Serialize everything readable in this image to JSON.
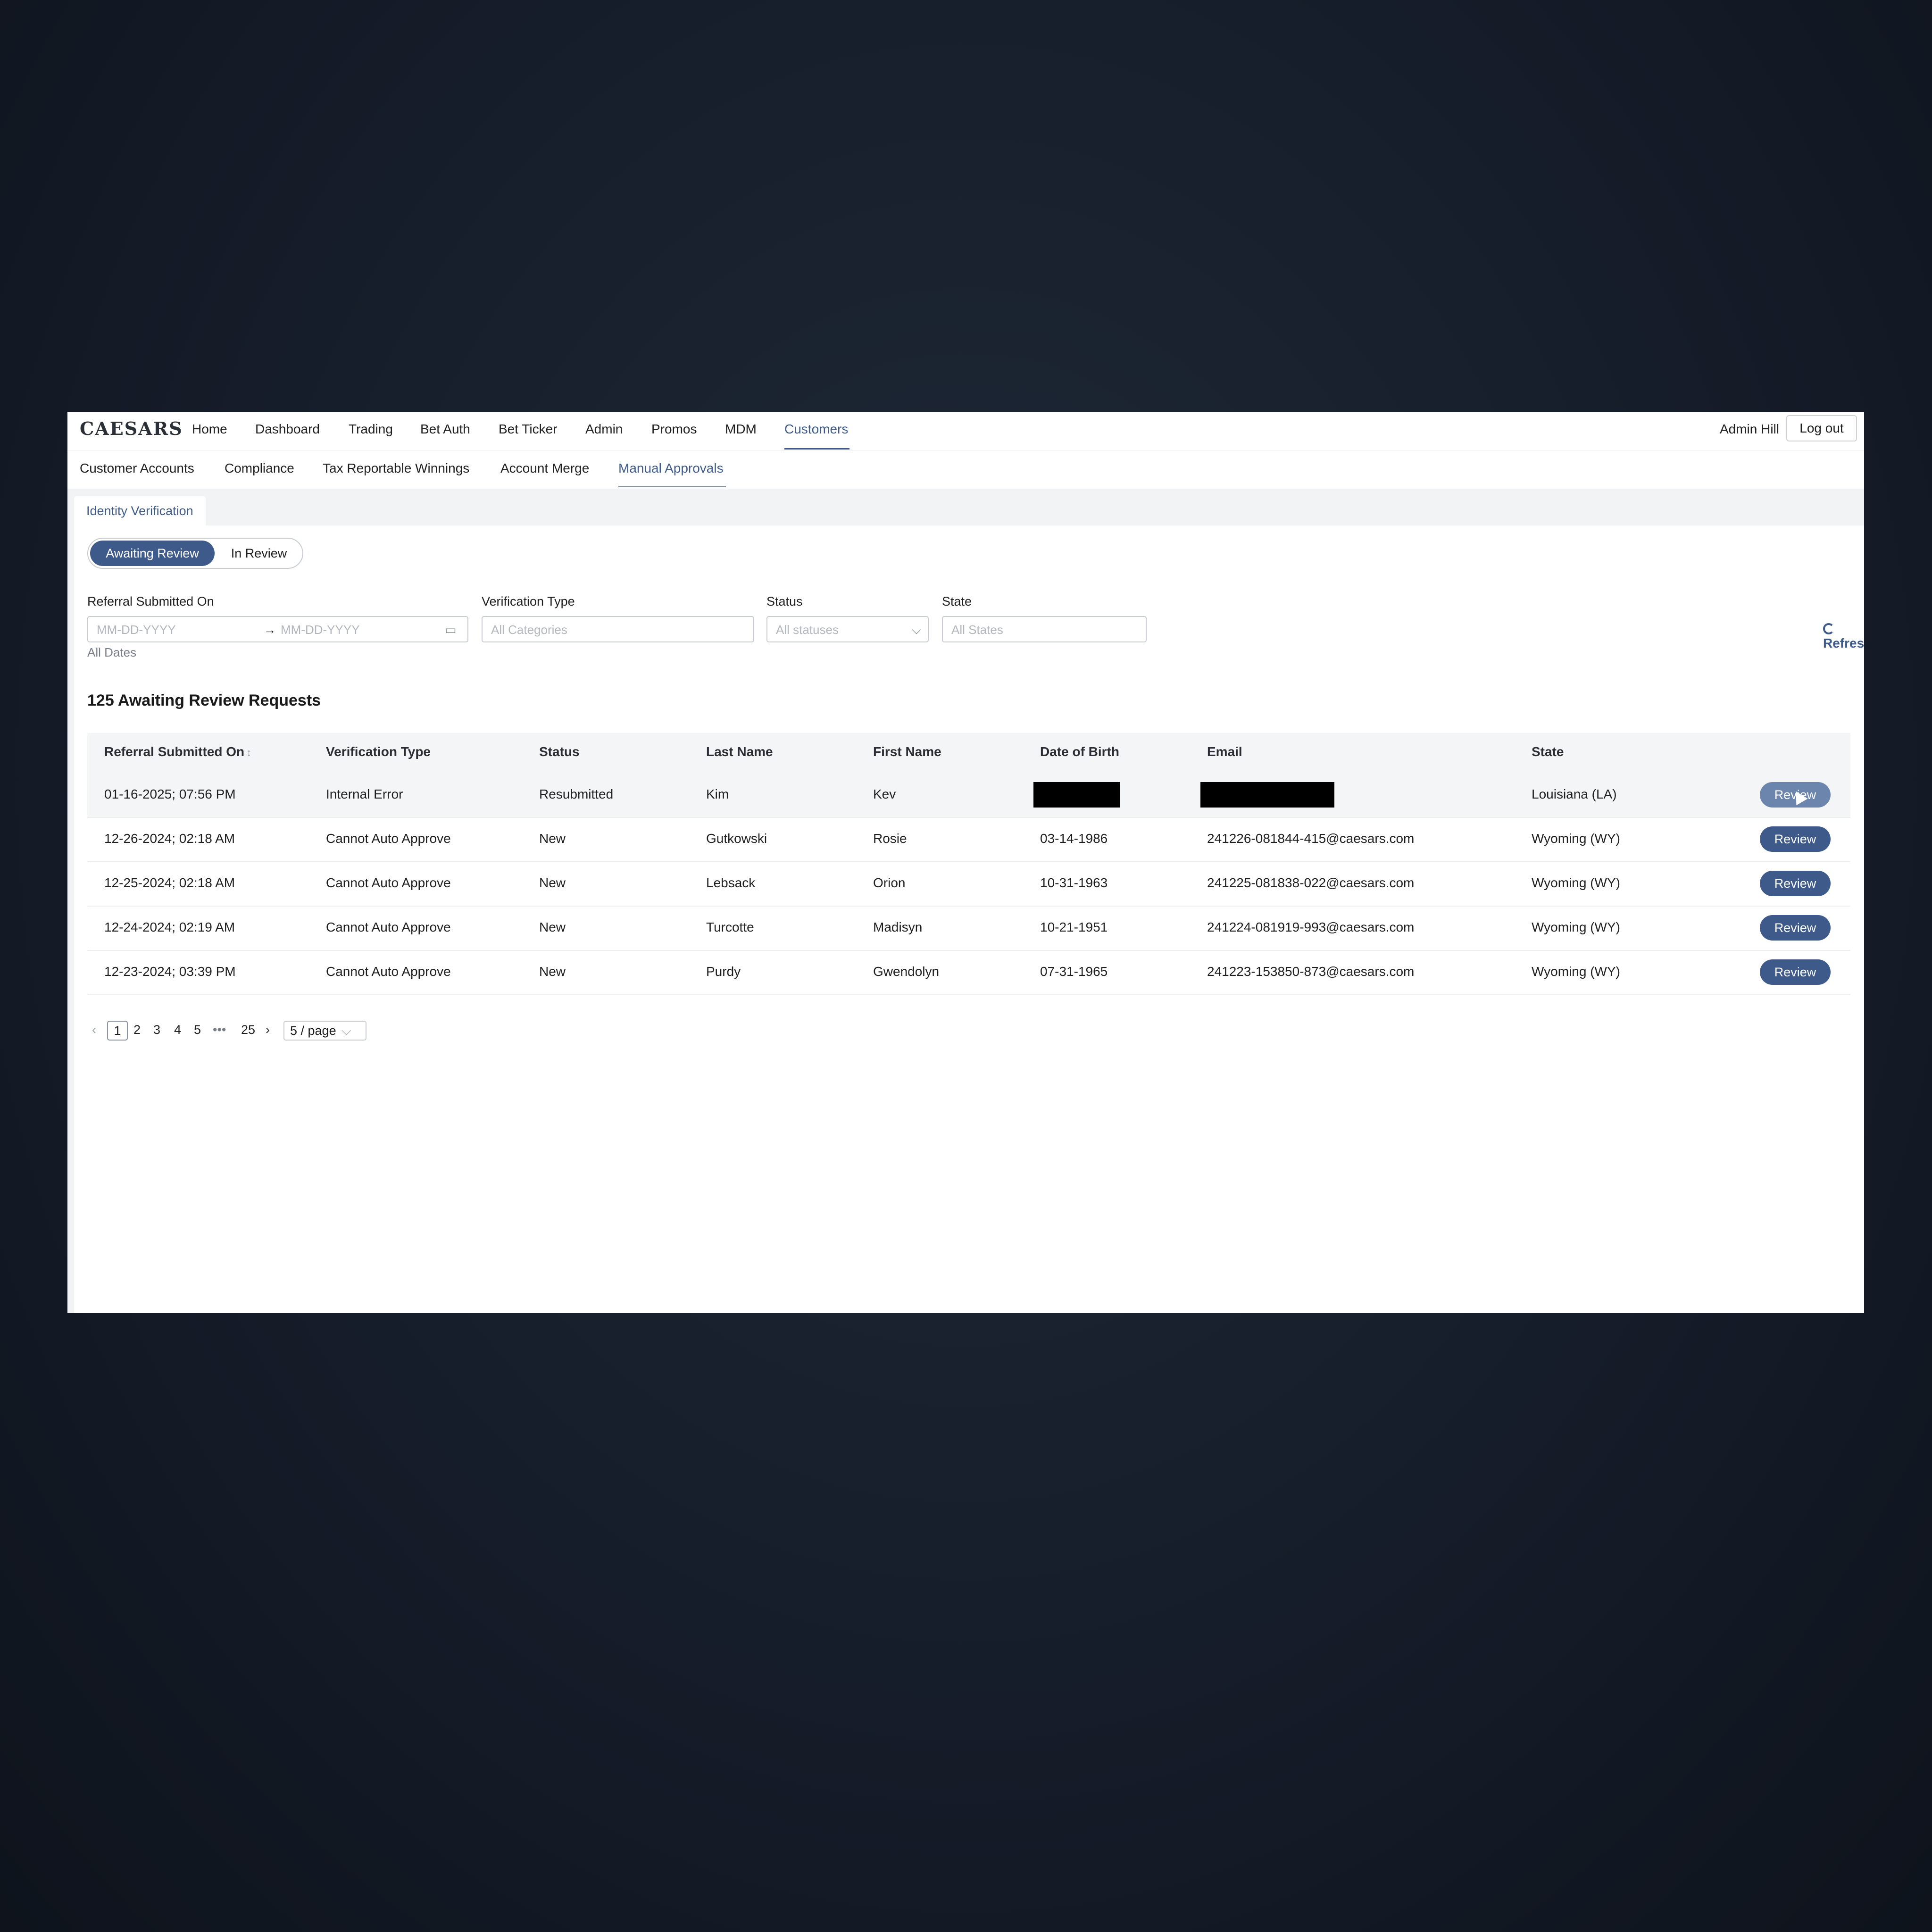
{
  "app": {
    "logo": "CAESARS"
  },
  "nav": {
    "items": [
      "Home",
      "Dashboard",
      "Trading",
      "Bet Auth",
      "Bet Ticker",
      "Admin",
      "Promos",
      "MDM",
      "Customers"
    ],
    "active": "Customers",
    "user": "Admin Hill",
    "logout": "Log out"
  },
  "subnav": {
    "items": [
      "Customer Accounts",
      "Compliance",
      "Tax Reportable Winnings",
      "Account Merge",
      "Manual Approvals"
    ],
    "active": "Manual Approvals"
  },
  "tab": {
    "label": "Identity Verification"
  },
  "toggle": {
    "awaiting": "Awaiting Review",
    "in_review": "In Review"
  },
  "filters": {
    "referral_label": "Referral Submitted On",
    "date_start_placeholder": "MM-DD-YYYY",
    "date_end_placeholder": "MM-DD-YYYY",
    "date_hint": "All Dates",
    "verification_label": "Verification Type",
    "verification_placeholder": "All Categories",
    "status_label": "Status",
    "status_placeholder": "All statuses",
    "state_label": "State",
    "state_placeholder": "All States",
    "refresh": "Refresh"
  },
  "heading": "125 Awaiting Review Requests",
  "table": {
    "columns": [
      "Referral Submitted On",
      "Verification Type",
      "Status",
      "Last Name",
      "First Name",
      "Date of Birth",
      "Email",
      "State"
    ],
    "action_label": "Review",
    "rows": [
      {
        "submitted": "01-16-2025; 07:56 PM",
        "type": "Internal Error",
        "status": "Resubmitted",
        "last": "Kim",
        "first": "Kev",
        "dob": "",
        "email": "",
        "state": "Louisiana (LA)",
        "redacted": true
      },
      {
        "submitted": "12-26-2024; 02:18 AM",
        "type": "Cannot Auto Approve",
        "status": "New",
        "last": "Gutkowski",
        "first": "Rosie",
        "dob": "03-14-1986",
        "email": "241226-081844-415@caesars.com",
        "state": "Wyoming (WY)"
      },
      {
        "submitted": "12-25-2024; 02:18 AM",
        "type": "Cannot Auto Approve",
        "status": "New",
        "last": "Lebsack",
        "first": "Orion",
        "dob": "10-31-1963",
        "email": "241225-081838-022@caesars.com",
        "state": "Wyoming (WY)"
      },
      {
        "submitted": "12-24-2024; 02:19 AM",
        "type": "Cannot Auto Approve",
        "status": "New",
        "last": "Turcotte",
        "first": "Madisyn",
        "dob": "10-21-1951",
        "email": "241224-081919-993@caesars.com",
        "state": "Wyoming (WY)"
      },
      {
        "submitted": "12-23-2024; 03:39 PM",
        "type": "Cannot Auto Approve",
        "status": "New",
        "last": "Purdy",
        "first": "Gwendolyn",
        "dob": "07-31-1965",
        "email": "241223-153850-873@caesars.com",
        "state": "Wyoming (WY)"
      }
    ]
  },
  "pagination": {
    "pages": [
      "1",
      "2",
      "3",
      "4",
      "5"
    ],
    "current": "1",
    "ellipsis": "•••",
    "last": "25",
    "page_size": "5 / page"
  },
  "colors": {
    "accent": "#3d5a8a",
    "background": "#161d2a"
  }
}
